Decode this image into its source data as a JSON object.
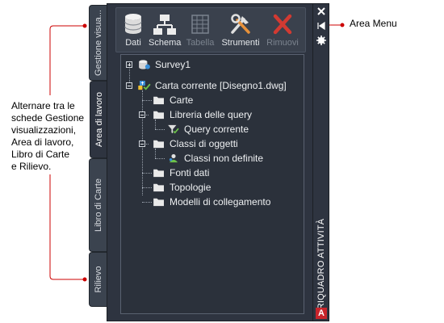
{
  "callouts": {
    "left_note": "Alternare tra le\nschede Gestione\nvisualizzazioni,\nArea di lavoro,\nLibro di Carte\ne Rilievo.",
    "area_menu": "Area Menu"
  },
  "side_tabs": [
    {
      "label": "Gestione visua...",
      "active": false
    },
    {
      "label": "Area di lavoro",
      "active": true
    },
    {
      "label": "Libro di Carte",
      "active": false
    },
    {
      "label": "Rilievo",
      "active": false
    }
  ],
  "toolbar": {
    "items": [
      {
        "label": "Dati",
        "icon": "database-icon",
        "enabled": true
      },
      {
        "label": "Schema",
        "icon": "schema-icon",
        "enabled": true
      },
      {
        "label": "Tabella",
        "icon": "table-icon",
        "enabled": false
      },
      {
        "label": "Strumenti",
        "icon": "tools-icon",
        "enabled": true
      },
      {
        "label": "Rimuovi",
        "icon": "remove-icon",
        "enabled": false
      }
    ]
  },
  "tree": {
    "survey": "Survey1",
    "current_map": "Carta corrente [Disegno1.dwg]",
    "carte": "Carte",
    "query_library": "Libreria delle query",
    "current_query": "Query corrente",
    "object_classes": "Classi di oggetti",
    "undefined_classes": "Classi non definite",
    "data_sources": "Fonti dati",
    "topologies": "Topologie",
    "link_templates": "Modelli di collegamento"
  },
  "strip": {
    "title": "RIQUADRO ATTIVITÀ",
    "close_icon": "close-icon",
    "autohide_icon": "auto-hide-icon",
    "settings_icon": "settings-icon",
    "logo_text": "A"
  },
  "colors": {
    "panel_bg": "#2e3440",
    "remove_red": "#d23a32",
    "arrow_red": "#cc0000"
  }
}
